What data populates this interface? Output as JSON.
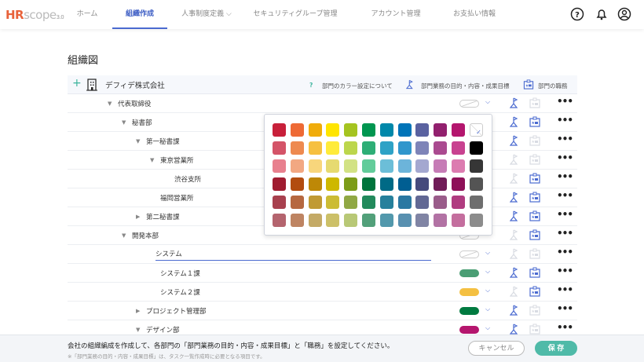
{
  "header": {
    "logo": {
      "hr": "HR",
      "scope": "scope",
      "version": "3.0"
    },
    "nav": [
      {
        "label": "ホーム",
        "active": false
      },
      {
        "label": "組織作成",
        "active": true
      },
      {
        "label": "人事制度定義 ⌵",
        "active": false
      },
      {
        "label": "セキュリティグループ管理",
        "active": false
      },
      {
        "label": "アカウント管理",
        "active": false
      },
      {
        "label": "お支払い情報",
        "active": false
      }
    ],
    "icons": [
      "help-icon",
      "bell-icon",
      "user-icon"
    ]
  },
  "page_title": "組織図",
  "company": {
    "name": "デフィデ株式会社",
    "legend_color": "部門のカラー設定について",
    "legend_goals": "部門業務の目的・内容・成果目標",
    "legend_duties": "部門の職務"
  },
  "rows": [
    {
      "label": "代表取締役",
      "caret": "down",
      "color": null,
      "flag": true,
      "duty": false
    },
    {
      "label": "秘書部",
      "caret": "down",
      "color": null,
      "flag": true,
      "duty": true
    },
    {
      "label": "第一秘書課",
      "caret": "down",
      "color": null,
      "flag": true,
      "duty": false
    },
    {
      "label": "東京営業所",
      "caret": "down",
      "color": null,
      "flag": false,
      "duty": false
    },
    {
      "label": "渋谷支所",
      "caret": null,
      "color": null,
      "flag": false,
      "duty": true
    },
    {
      "label": "福岡営業所",
      "caret": null,
      "color": null,
      "flag": true,
      "duty": true
    },
    {
      "label": "第二秘書課",
      "caret": "right",
      "color": null,
      "flag": true,
      "duty": true
    },
    {
      "label": "開発本部",
      "caret": "down",
      "color": null,
      "flag": false,
      "duty": true
    },
    {
      "label": "システム",
      "caret": null,
      "color": null,
      "flag": false,
      "duty": false,
      "editing": true
    },
    {
      "label": "システム１課",
      "caret": null,
      "color": "#4a9e74",
      "flag": true,
      "duty": true
    },
    {
      "label": "システム２課",
      "caret": null,
      "color": "#f4c042",
      "flag": false,
      "duty": true
    },
    {
      "label": "プロジェクト管理部",
      "caret": "right",
      "color": "#007a40",
      "flag": true,
      "duty": false
    },
    {
      "label": "デザイン部",
      "caret": "down",
      "color": "#b5166e",
      "flag": true,
      "duty": false
    }
  ],
  "palette": [
    [
      "#c8203a",
      "#ee6a35",
      "#f0ac0a",
      "#ffe500",
      "#a5c420",
      "#009650",
      "#0088aa",
      "#0074b8",
      "#5a62a0",
      "#92206e",
      "#b4166e",
      "none"
    ],
    [
      "#d45468",
      "#ee8a50",
      "#f6c040",
      "#ffeb3a",
      "#bcd64c",
      "#2eae76",
      "#2ea2c6",
      "#3096cc",
      "#7e84b8",
      "#aa4a90",
      "#c84290",
      "#000000"
    ],
    [
      "#e8808e",
      "#f2a882",
      "#f8d67c",
      "#e6da70",
      "#d2e284",
      "#62cc9a",
      "#6cbed8",
      "#6cb4da",
      "#a4a8d0",
      "#c67cb6",
      "#dc7cb0",
      "#363636"
    ],
    [
      "#a01c30",
      "#b24c10",
      "#be8806",
      "#ceb800",
      "#7c9c18",
      "#00743c",
      "#006a86",
      "#005e92",
      "#464a7c",
      "#701c58",
      "#8e1058",
      "#545454"
    ],
    [
      "#a8404e",
      "#b66840",
      "#c09a34",
      "#ccbc34",
      "#90a844",
      "#228a5c",
      "#26809c",
      "#2a78a2",
      "#626894",
      "#9a5c8a",
      "#b03c80",
      "#6e6e6e"
    ],
    [
      "#b4646e",
      "#be8462",
      "#c4aa66",
      "#ccc068",
      "#b8c876",
      "#52a07a",
      "#5298ac",
      "#5890b0",
      "#8084a4",
      "#b272a4",
      "#c46e9e",
      "#8c8c8c"
    ]
  ],
  "footer": {
    "message": "会社の組織編成を作成して、各部門の「部門業務の目的・内容・成果目標」と「職務」を設定してください。",
    "note": "※「部門業務の目的・内容・成果目標」は、タスク一覧作成時に必要となる項目です。",
    "cancel": "キャンセル",
    "save": "保 存"
  },
  "colors": {
    "accent": "#4a6ad0",
    "save": "#4fbaa8",
    "logo": "#e8623a"
  }
}
